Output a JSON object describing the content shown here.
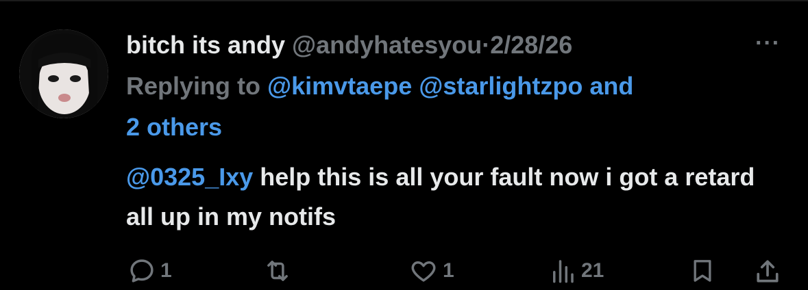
{
  "tweet": {
    "display_name": "bitch its andy",
    "handle": "@andyhatesyou",
    "separator": "·",
    "date": "2/28/26",
    "more_icon": "more-horizontal-icon",
    "replying_prefix": "Replying to",
    "replying_to": [
      "@kimvtaepe",
      "@starlightzpo"
    ],
    "replying_and": "and",
    "replying_others": "2 others",
    "body_mention": "@0325_Ixy",
    "body_text": "help this is all your fault now i got a retard all up in my notifs"
  },
  "actions": {
    "reply_count": "1",
    "retweet_count": "",
    "like_count": "1",
    "views_count": "21"
  },
  "colors": {
    "background": "#000000",
    "primary_text": "#e7e9ea",
    "secondary_text": "#71767b",
    "link": "#4a99e9"
  }
}
